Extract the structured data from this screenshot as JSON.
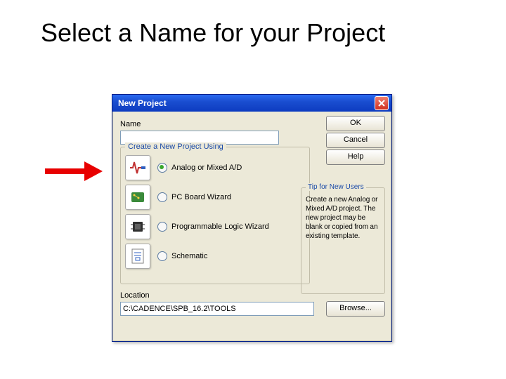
{
  "slide": {
    "title": "Select a Name for your Project"
  },
  "dialog": {
    "title": "New Project",
    "name_label": "Name",
    "name_value": "",
    "buttons": {
      "ok": "OK",
      "cancel": "Cancel",
      "help": "Help"
    },
    "group_title": "Create a New Project Using",
    "project_types": [
      {
        "label": "Analog or Mixed A/D",
        "selected": true
      },
      {
        "label": "PC Board Wizard",
        "selected": false
      },
      {
        "label": "Programmable Logic Wizard",
        "selected": false
      },
      {
        "label": "Schematic",
        "selected": false
      }
    ],
    "tip": {
      "title": "Tip for New Users",
      "text": "Create a new Analog or Mixed A/D project. The new project may be blank or copied from an existing template."
    },
    "location_label": "Location",
    "location_value": "C:\\CADENCE\\SPB_16.2\\TOOLS",
    "browse": "Browse..."
  }
}
